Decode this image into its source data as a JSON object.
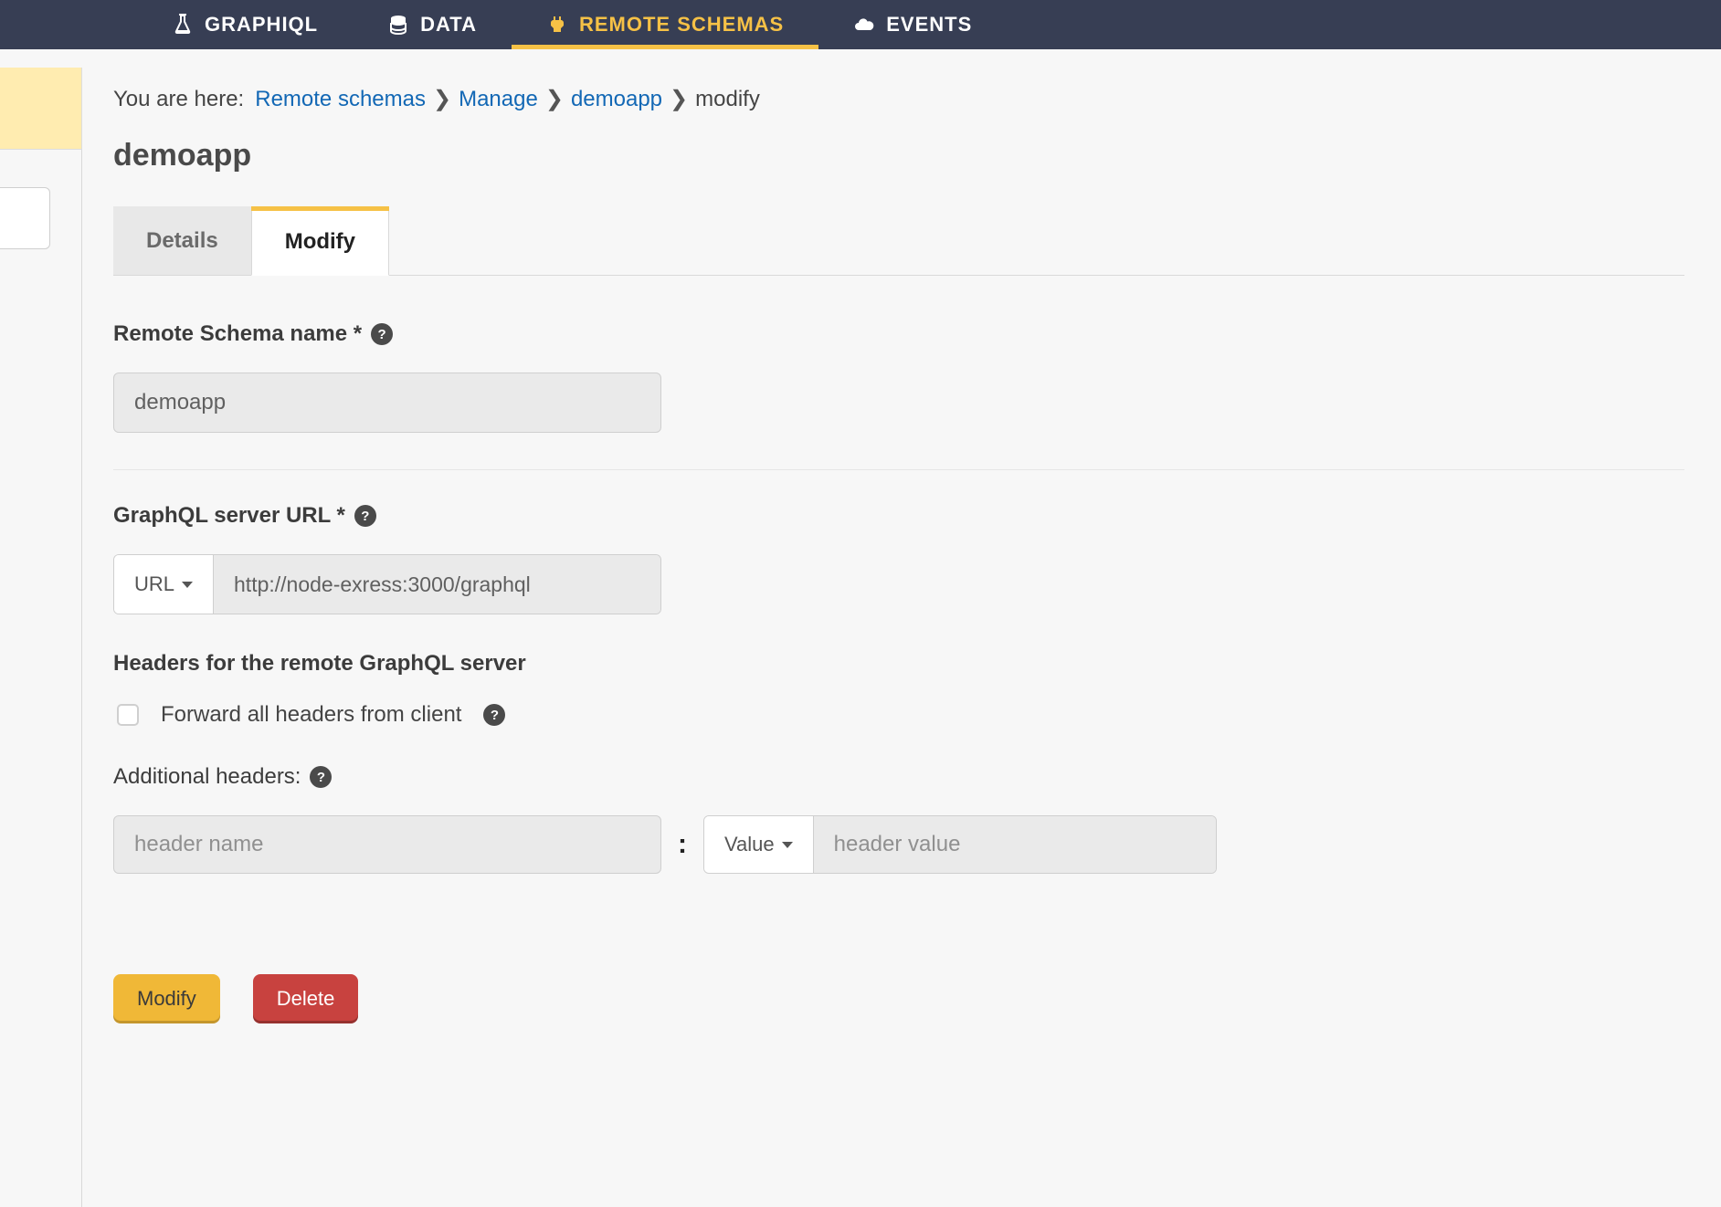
{
  "nav": {
    "items": [
      {
        "label": "GRAPHIQL",
        "icon": "flask-icon",
        "active": false
      },
      {
        "label": "DATA",
        "icon": "database-icon",
        "active": false
      },
      {
        "label": "REMOTE SCHEMAS",
        "icon": "plug-icon",
        "active": true
      },
      {
        "label": "EVENTS",
        "icon": "cloud-icon",
        "active": false
      }
    ]
  },
  "breadcrumb": {
    "here_label": "You are here:",
    "items": [
      {
        "label": "Remote schemas",
        "link": true
      },
      {
        "label": "Manage",
        "link": true
      },
      {
        "label": "demoapp",
        "link": true
      },
      {
        "label": "modify",
        "link": false
      }
    ]
  },
  "page": {
    "title": "demoapp"
  },
  "tabs": {
    "details": "Details",
    "modify": "Modify"
  },
  "form": {
    "name_label": "Remote Schema name *",
    "name_value": "demoapp",
    "url_label": "GraphQL server URL *",
    "url_type": "URL",
    "url_value": "http://node-exress:3000/graphql",
    "headers_label": "Headers for the remote GraphQL server",
    "forward_label": "Forward all headers from client",
    "additional_label": "Additional headers:",
    "header_name_placeholder": "header name",
    "header_value_type": "Value",
    "header_value_placeholder": "header value",
    "modify_btn": "Modify",
    "delete_btn": "Delete"
  }
}
